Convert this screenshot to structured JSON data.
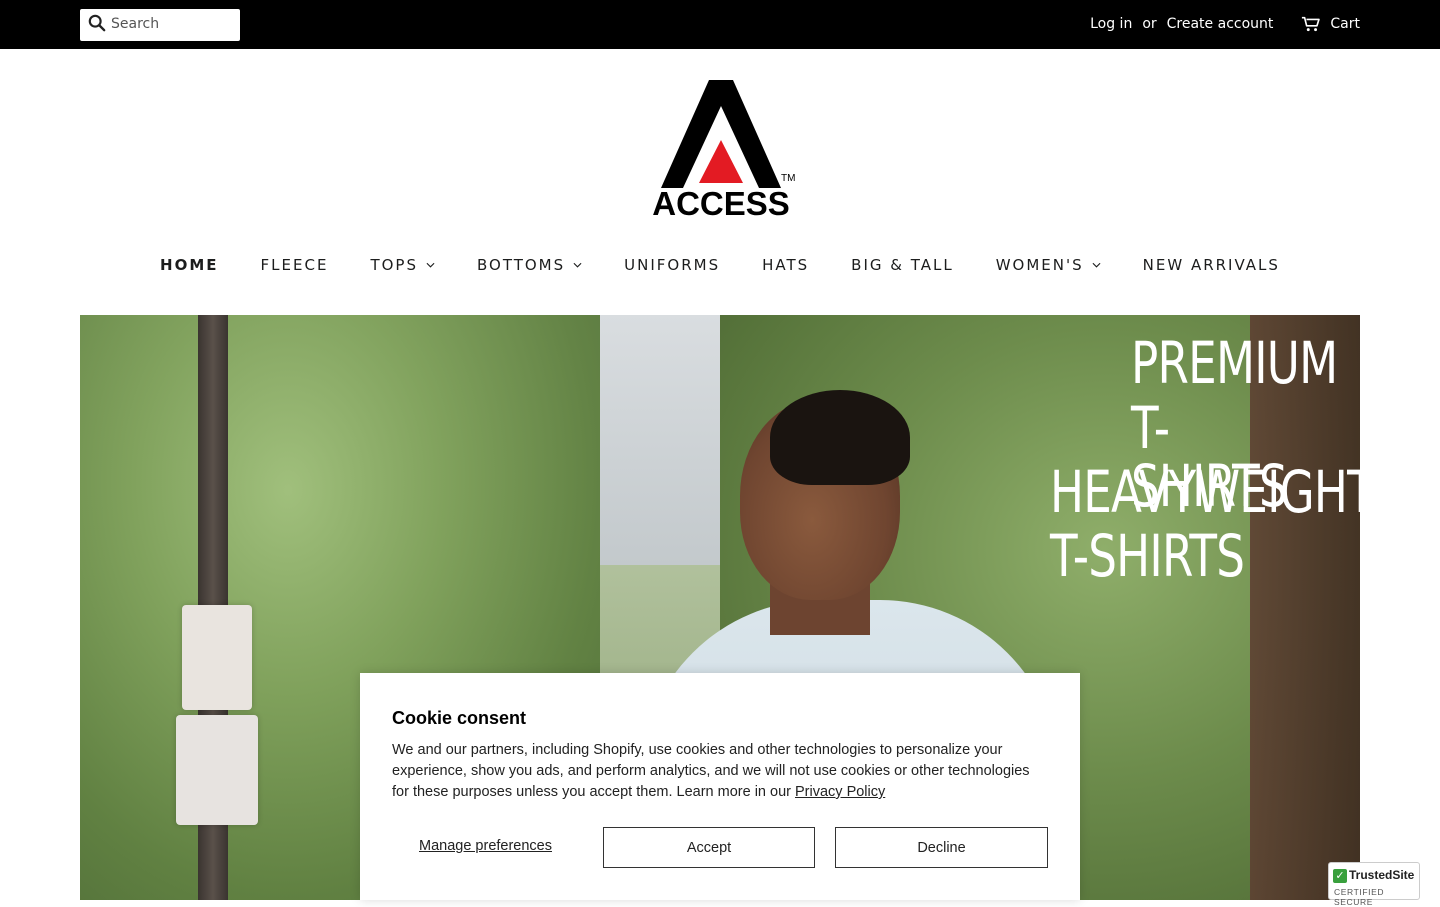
{
  "topbar": {
    "search_placeholder": "Search",
    "login": "Log in",
    "or": "or",
    "create_account": "Create account",
    "cart": "Cart"
  },
  "logo": {
    "brand": "ACCESS",
    "trademark": "TM",
    "accent_color": "#e31b23"
  },
  "nav": {
    "items": [
      {
        "label": "HOME",
        "active": true,
        "dropdown": false
      },
      {
        "label": "FLEECE",
        "active": false,
        "dropdown": false
      },
      {
        "label": "TOPS",
        "active": false,
        "dropdown": true
      },
      {
        "label": "BOTTOMS",
        "active": false,
        "dropdown": true
      },
      {
        "label": "UNIFORMS",
        "active": false,
        "dropdown": false
      },
      {
        "label": "HATS",
        "active": false,
        "dropdown": false
      },
      {
        "label": "BIG & TALL",
        "active": false,
        "dropdown": false
      },
      {
        "label": "WOMEN'S",
        "active": false,
        "dropdown": true
      },
      {
        "label": "NEW ARRIVALS",
        "active": false,
        "dropdown": false
      }
    ]
  },
  "hero": {
    "line1": "PREMIUM",
    "line2": "T-SHIRTS",
    "line3": "HEAVYWEIGHT",
    "line4": "T-SHIRTS"
  },
  "cookie": {
    "title": "Cookie consent",
    "body": "We and our partners, including Shopify, use cookies and other technologies to personalize your experience, show you ads, and perform analytics, and we will not use cookies or other technologies for these purposes unless you accept them. Learn more in our ",
    "privacy_link": "Privacy Policy",
    "manage": "Manage preferences",
    "accept": "Accept",
    "decline": "Decline"
  },
  "trusted": {
    "name": "TrustedSite",
    "sub": "CERTIFIED SECURE"
  }
}
